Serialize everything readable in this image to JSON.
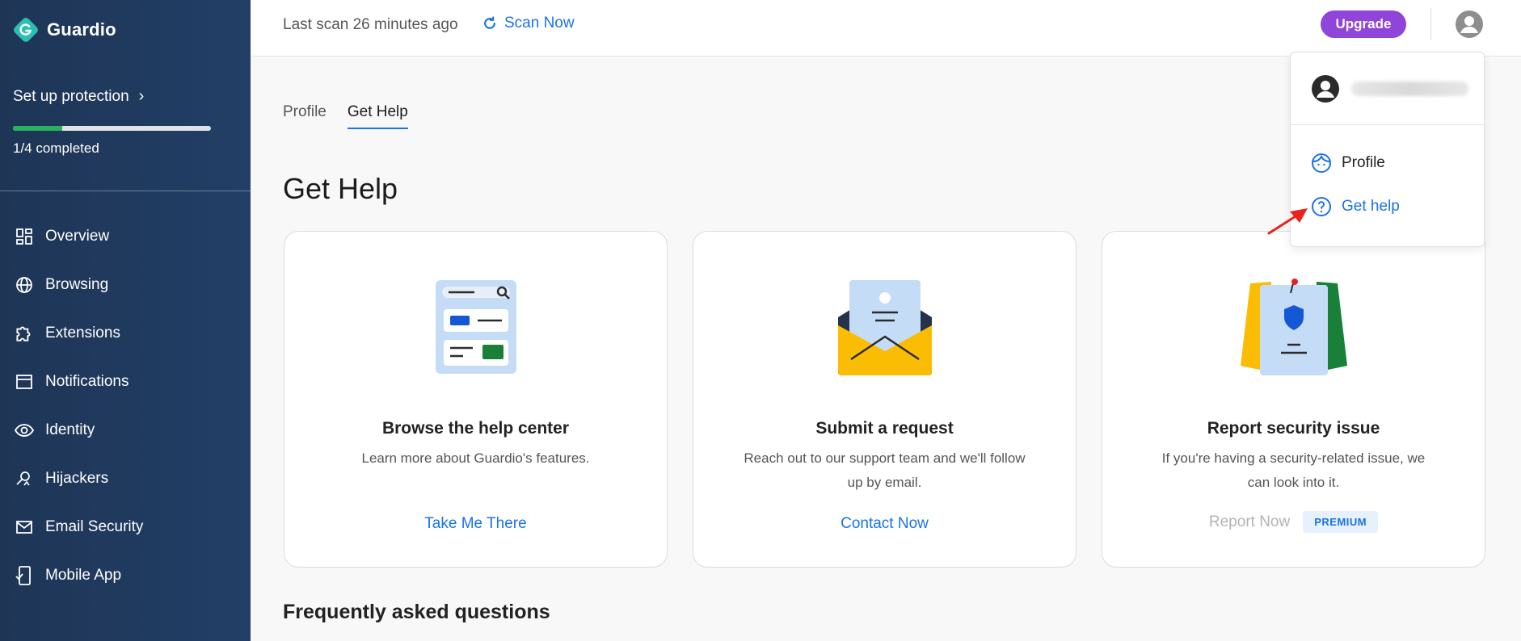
{
  "app": {
    "name": "Guardio"
  },
  "sidebar": {
    "setup_label": "Set up protection",
    "setup_chevron": "›",
    "progress_fraction": 0.25,
    "completed_text": "1/4 completed",
    "items": [
      {
        "label": "Overview",
        "icon": "grid-icon"
      },
      {
        "label": "Browsing",
        "icon": "globe-icon"
      },
      {
        "label": "Extensions",
        "icon": "puzzle-icon"
      },
      {
        "label": "Notifications",
        "icon": "browser-window-icon"
      },
      {
        "label": "Identity",
        "icon": "eye-icon"
      },
      {
        "label": "Hijackers",
        "icon": "user-search-icon"
      },
      {
        "label": "Email Security",
        "icon": "mail-icon"
      },
      {
        "label": "Mobile App",
        "icon": "phone-icon"
      }
    ]
  },
  "topbar": {
    "last_scan": "Last scan 26 minutes ago",
    "scan_now": "Scan Now",
    "upgrade": "Upgrade"
  },
  "tabs": [
    {
      "label": "Profile",
      "active": false
    },
    {
      "label": "Get Help",
      "active": true
    }
  ],
  "page_title": "Get Help",
  "cards": [
    {
      "title": "Browse the help center",
      "description": "Learn more about Guardio's features.",
      "cta": "Take Me There"
    },
    {
      "title": "Submit a request",
      "description": "Reach out to our support team and we'll follow up by email.",
      "cta": "Contact Now"
    },
    {
      "title": "Report security issue",
      "description": "If you're having a security-related issue, we can look into it.",
      "cta": "Report Now",
      "badge": "PREMIUM"
    }
  ],
  "faq_title": "Frequently asked questions",
  "dropdown": {
    "items": [
      {
        "label": "Profile",
        "icon": "face-icon"
      },
      {
        "label": "Get help",
        "icon": "question-circle-icon"
      }
    ]
  },
  "colors": {
    "accent": "#1a73e8",
    "upgrade": "#8f45d9",
    "progress": "#27b35f",
    "sidebar": "#1e3556",
    "arrow": "#e8231a"
  }
}
